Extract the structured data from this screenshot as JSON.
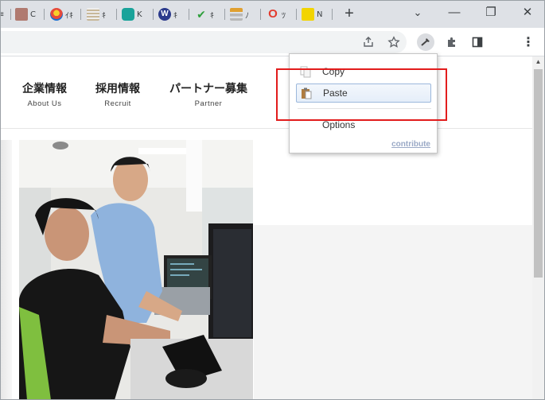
{
  "browser": {
    "tabs": [
      {
        "label": "C",
        "favicon_color": "#b07a70"
      },
      {
        "label": "ｲｷ",
        "favicon_color": "#e64a3b"
      },
      {
        "label": "ｷ",
        "favicon_color": "#c8b89a"
      },
      {
        "label": "K",
        "favicon_color": "#1aa39a"
      },
      {
        "label": "ｷ",
        "favicon_color": "#2b3a8c"
      },
      {
        "label": "ｷ",
        "favicon_color": "#2e9f3c"
      },
      {
        "label": "ﾉ",
        "favicon_color": "#e0a030"
      },
      {
        "label": "ﾂ",
        "favicon_color": "#e33b2e"
      },
      {
        "label": "N",
        "favicon_color": "#f2d400"
      }
    ],
    "new_tab_label": "+",
    "window_controls": {
      "minimize": "—",
      "restore": "❐",
      "close": "✕",
      "tab_search": "⌄"
    },
    "toolbar_icons": [
      "share-icon",
      "bookmark-star-icon",
      "clipboard-extension-icon",
      "extensions-puzzle-icon",
      "side-panel-icon",
      "more-menu-icon"
    ],
    "menu_dots": "⋮"
  },
  "site": {
    "nav": [
      {
        "jp": "企業情報",
        "en": "About Us"
      },
      {
        "jp": "採用情報",
        "en": "Recruit"
      },
      {
        "jp": "パートナー募集",
        "en": "Partner"
      }
    ]
  },
  "context_menu": {
    "items": [
      {
        "label": "Copy",
        "icon": "copy-icon"
      },
      {
        "label": "Paste",
        "icon": "paste-icon",
        "selected": true
      },
      {
        "label": "Options",
        "icon": ""
      }
    ],
    "footer_link": "contribute"
  },
  "colors": {
    "highlight_box": "#e21c1c",
    "menu_selected_border": "#9cb8dc",
    "contribute_link": "#9aa9c6"
  }
}
